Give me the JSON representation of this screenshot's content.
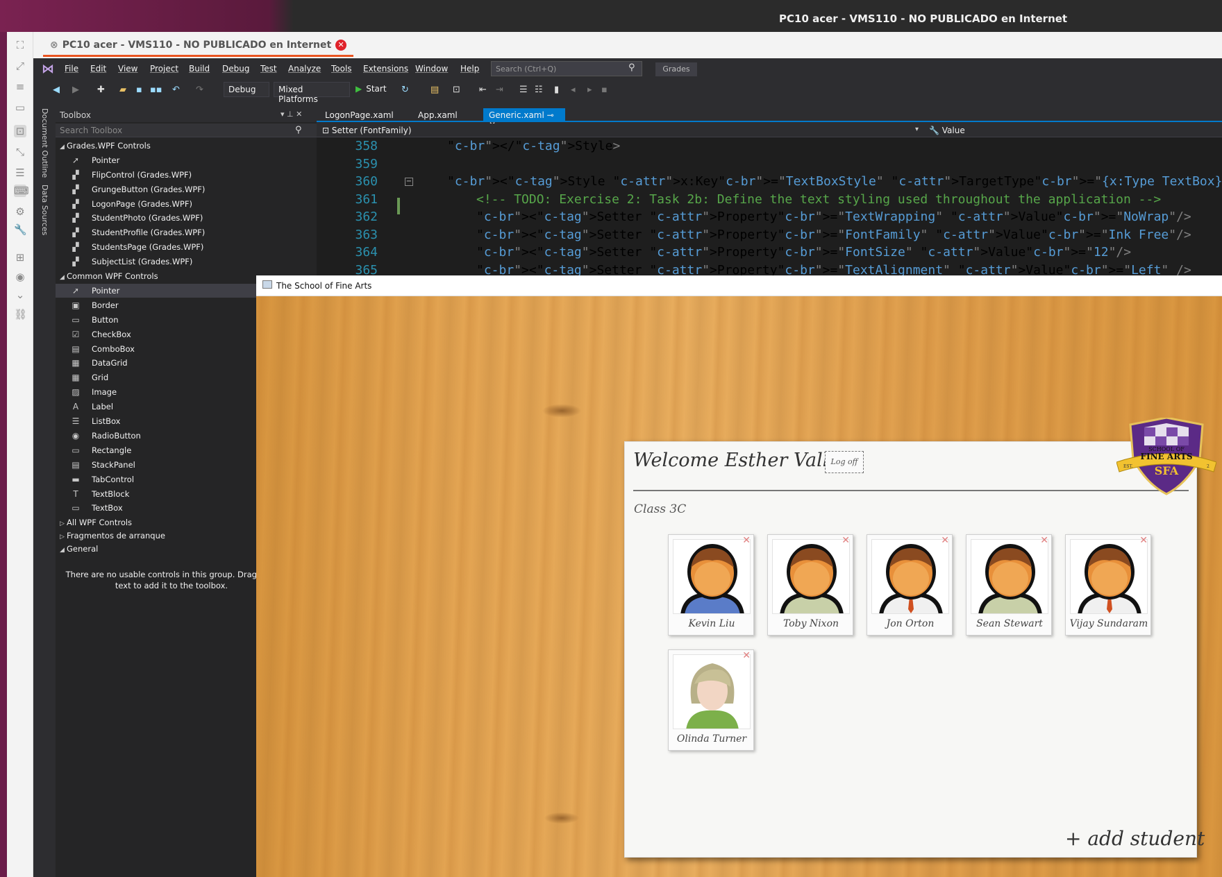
{
  "os": {
    "window_title": "PC10 acer - VMS110 - NO PUBLICADO en Internet",
    "tab_title": "PC10 acer - VMS110 - NO PUBLICADO en Internet"
  },
  "vs": {
    "menu": [
      "File",
      "Edit",
      "View",
      "Project",
      "Build",
      "Debug",
      "Test",
      "Analyze",
      "Tools",
      "Extensions",
      "Window",
      "Help"
    ],
    "search_placeholder": "Search (Ctrl+Q)",
    "solution_badge": "Grades",
    "config": "Debug",
    "platform": "Mixed Platforms",
    "start_label": "Start",
    "side_tabs": [
      "Document Outline",
      "Data Sources"
    ]
  },
  "toolbox": {
    "title": "Toolbox",
    "search_placeholder": "Search Toolbox",
    "groups": [
      {
        "label": "Grades.WPF Controls",
        "expanded": true,
        "items": [
          "Pointer",
          "FlipControl (Grades.WPF)",
          "GrungeButton (Grades.WPF)",
          "LogonPage (Grades.WPF)",
          "StudentPhoto (Grades.WPF)",
          "StudentProfile (Grades.WPF)",
          "StudentsPage (Grades.WPF)",
          "SubjectList (Grades.WPF)"
        ]
      },
      {
        "label": "Common WPF Controls",
        "expanded": true,
        "items": [
          "Pointer",
          "Border",
          "Button",
          "CheckBox",
          "ComboBox",
          "DataGrid",
          "Grid",
          "Image",
          "Label",
          "ListBox",
          "RadioButton",
          "Rectangle",
          "StackPanel",
          "TabControl",
          "TextBlock",
          "TextBox"
        ]
      },
      {
        "label": "All WPF Controls",
        "expanded": false,
        "items": []
      },
      {
        "label": "Fragmentos de arranque",
        "expanded": false,
        "items": []
      },
      {
        "label": "General",
        "expanded": true,
        "items": []
      }
    ],
    "selected_item": "Pointer",
    "empty_line1": "There are no usable controls in this group. Drag an it",
    "empty_line2": "text to add it to the toolbox."
  },
  "editor": {
    "tabs": [
      {
        "label": "LogonPage.xaml",
        "active": false
      },
      {
        "label": "App.xaml",
        "active": false
      },
      {
        "label": "Generic.xaml",
        "active": true
      }
    ],
    "nav_left": "Setter (FontFamily)",
    "nav_right": "Value",
    "lines": [
      {
        "num": "358",
        "text": "</Style>"
      },
      {
        "num": "359",
        "text": ""
      },
      {
        "num": "360",
        "text": "<Style x:Key=\"TextBoxStyle\" TargetType=\"{x:Type TextBox}\">"
      },
      {
        "num": "361",
        "text": "<!-- TODO: Exercise 2: Task 2b: Define the text styling used throughout the application -->"
      },
      {
        "num": "362",
        "text": "<Setter Property=\"TextWrapping\" Value=\"NoWrap\"/>"
      },
      {
        "num": "363",
        "text": "<Setter Property=\"FontFamily\" Value=\"Ink Free\"/>"
      },
      {
        "num": "364",
        "text": "<Setter Property=\"FontSize\" Value=\"12\"/>"
      },
      {
        "num": "365",
        "text": "<Setter Property=\"TextAlignment\" Value=\"Left\" />"
      }
    ]
  },
  "app": {
    "title": "The School of Fine Arts",
    "welcome": "Welcome Esther Valle!",
    "logoff": "Log off",
    "class_label": "Class 3C",
    "add_student": "+ add student",
    "crest_top": "SCHOOL OF",
    "crest_middle": "FINE ARTS",
    "crest_bottom": "SFA",
    "crest_ribbon_left": "EST.",
    "crest_ribbon_right": "2",
    "students": [
      {
        "name": "Kevin Liu",
        "avatar": "male-sweater-icon"
      },
      {
        "name": "Toby Nixon",
        "avatar": "male-shirt-icon"
      },
      {
        "name": "Jon Orton",
        "avatar": "male-tie-icon"
      },
      {
        "name": "Sean Stewart",
        "avatar": "male-shirt-icon"
      },
      {
        "name": "Vijay Sundaram",
        "avatar": "male-tie-icon"
      },
      {
        "name": "Olinda Turner",
        "avatar": "female-icon"
      }
    ],
    "colors": {
      "crest_purple": "#5b2a86",
      "crest_gold": "#f2c230",
      "wood": "#e2a252"
    }
  }
}
